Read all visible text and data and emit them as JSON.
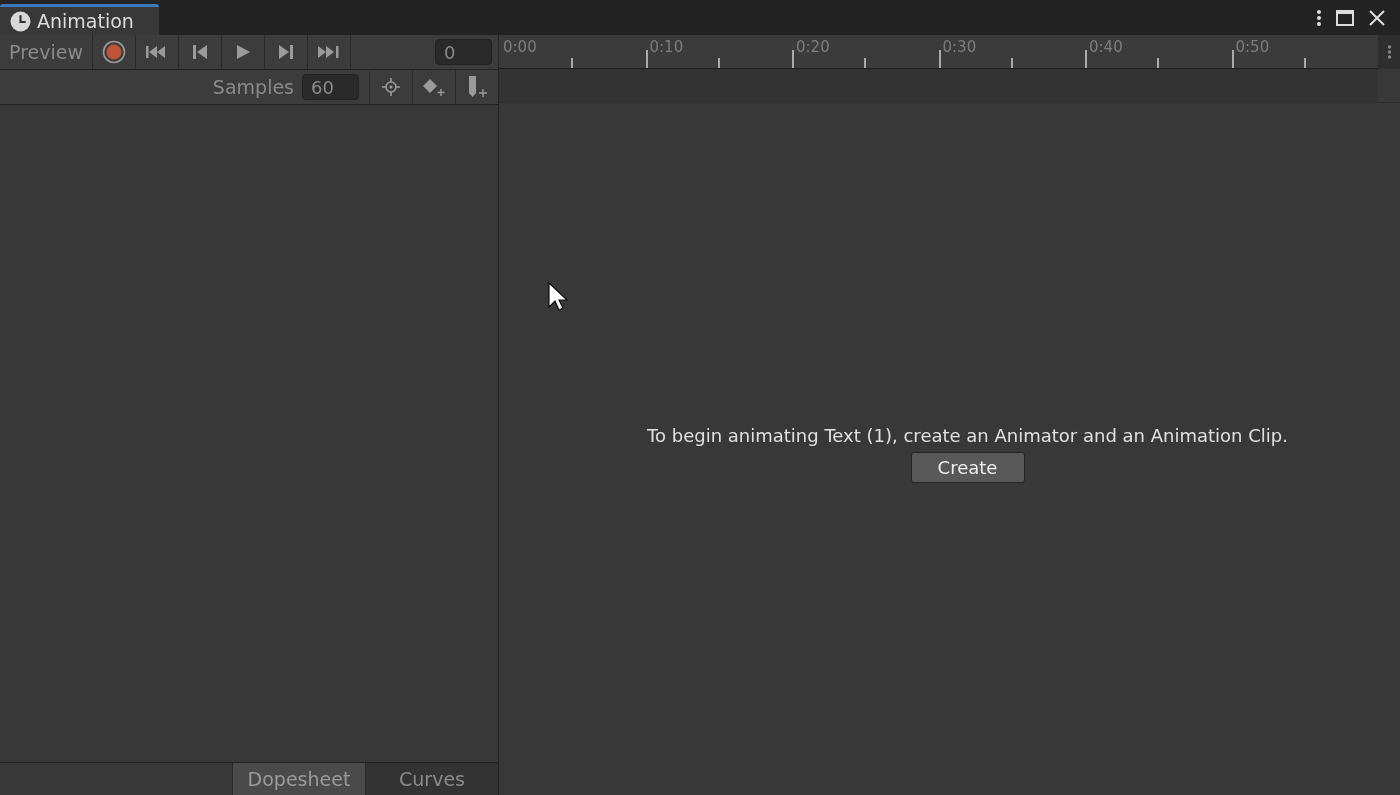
{
  "window": {
    "tab": "Animation"
  },
  "toolbar": {
    "preview": "Preview",
    "frame": "0",
    "samples_label": "Samples",
    "samples": "60"
  },
  "ruler": {
    "ticks": [
      "0:00",
      "0:10",
      "0:20",
      "0:30",
      "0:40",
      "0:50"
    ]
  },
  "message": "To begin animating Text (1), create an Animator and an Animation Clip.",
  "create_button": "Create",
  "view_tabs": [
    {
      "label": "Dopesheet",
      "selected": true
    },
    {
      "label": "Curves",
      "selected": false
    }
  ]
}
